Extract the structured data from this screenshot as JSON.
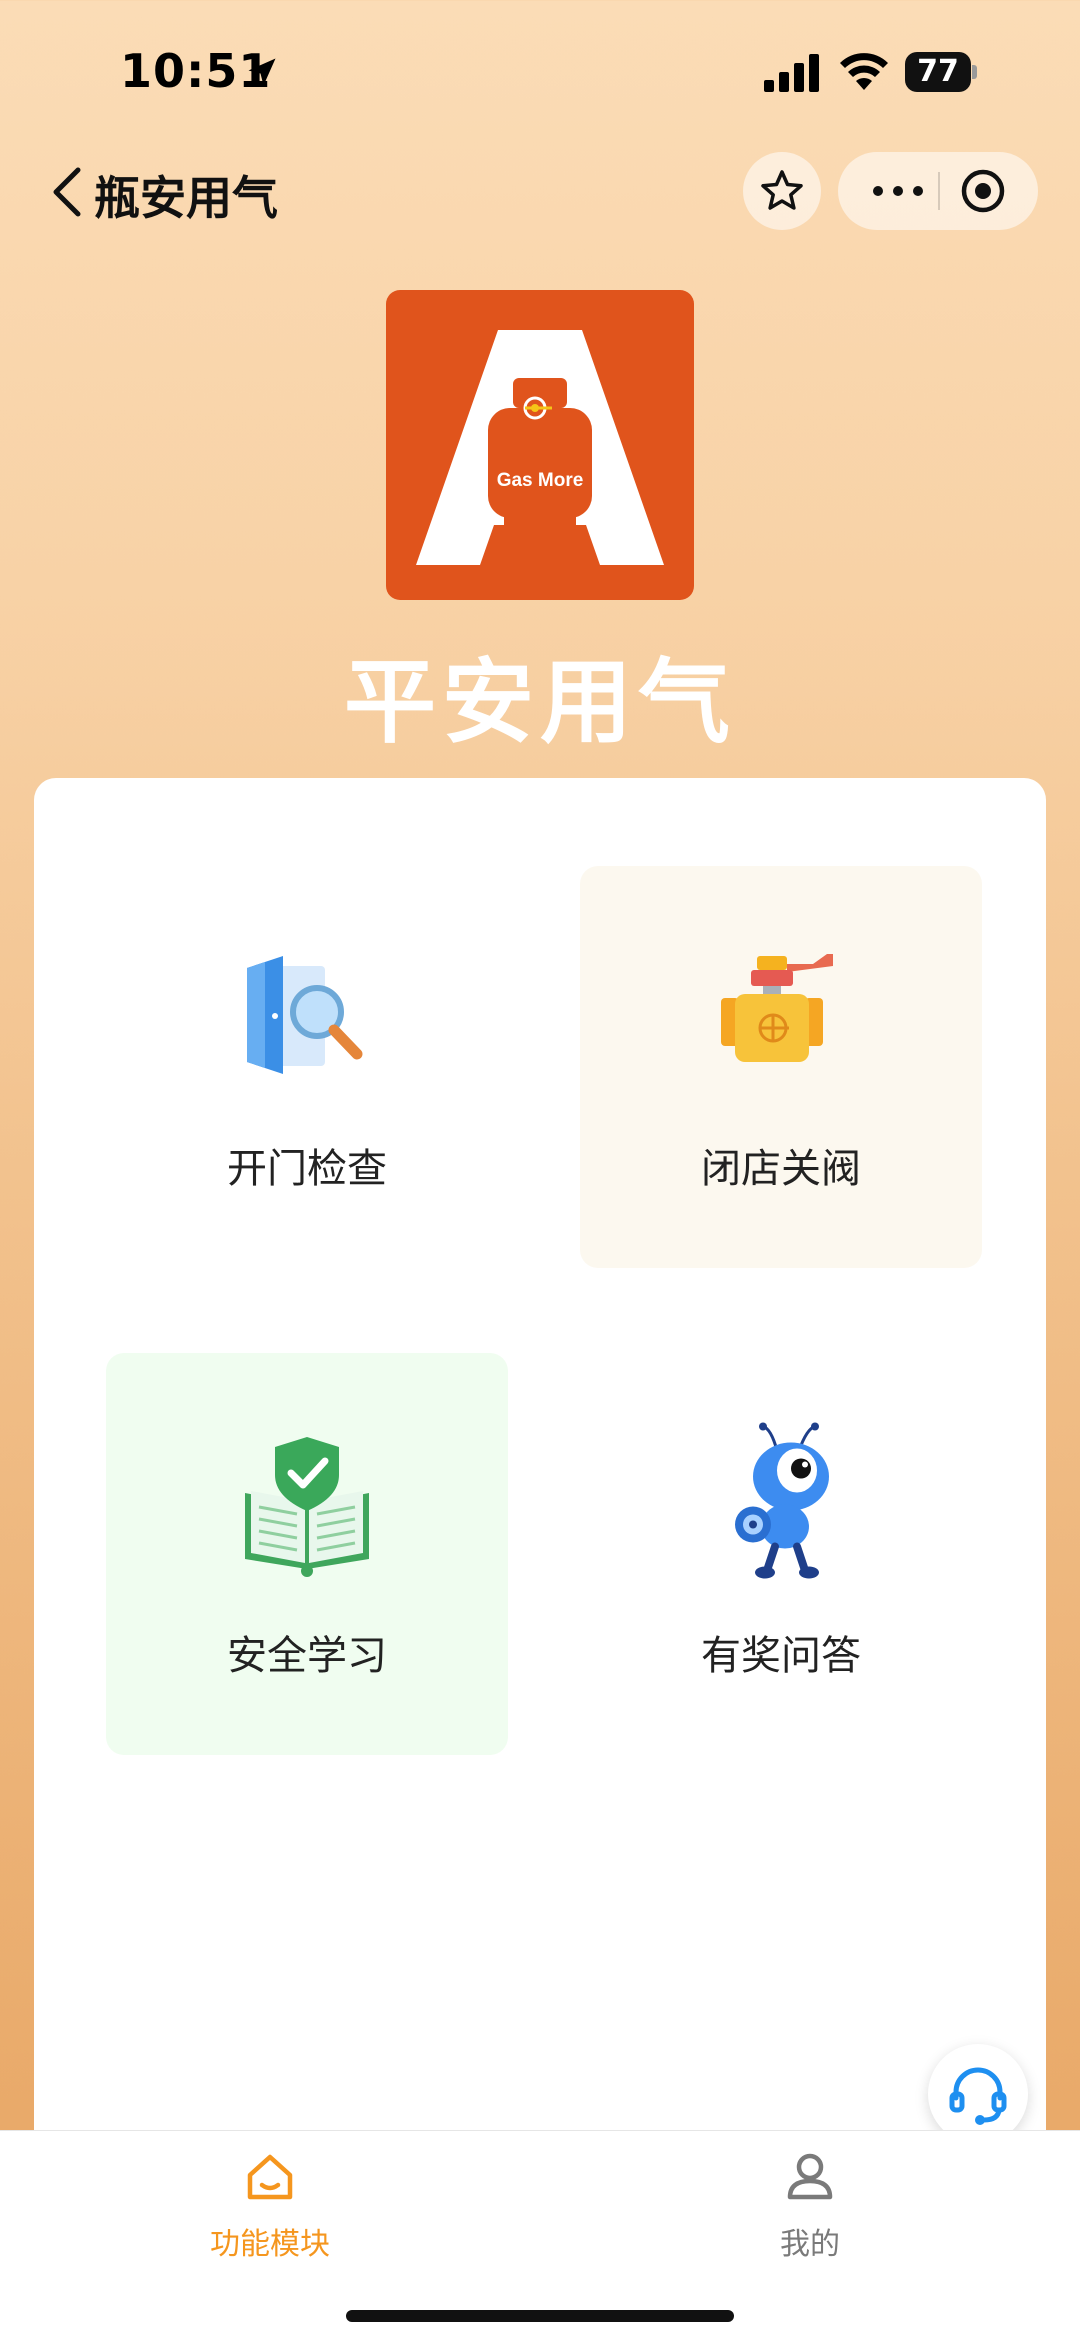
{
  "status_bar": {
    "time": "10:51",
    "battery": "77"
  },
  "nav": {
    "title": "瓶安用气"
  },
  "logo": {
    "badge_text": "Gas More",
    "brand_title": "平安用气"
  },
  "modules": [
    {
      "label": "开门检查",
      "icon": "door-magnifier-icon"
    },
    {
      "label": "闭店关阀",
      "icon": "gas-valve-icon"
    },
    {
      "label": "安全学习",
      "icon": "shield-book-icon"
    },
    {
      "label": "有奖问答",
      "icon": "ant-mascot-icon"
    }
  ],
  "tabbar": {
    "tab1_label": "功能模块",
    "tab2_label": "我的"
  },
  "colors": {
    "accent": "#f5961e",
    "logo_bg": "#e0541c"
  }
}
